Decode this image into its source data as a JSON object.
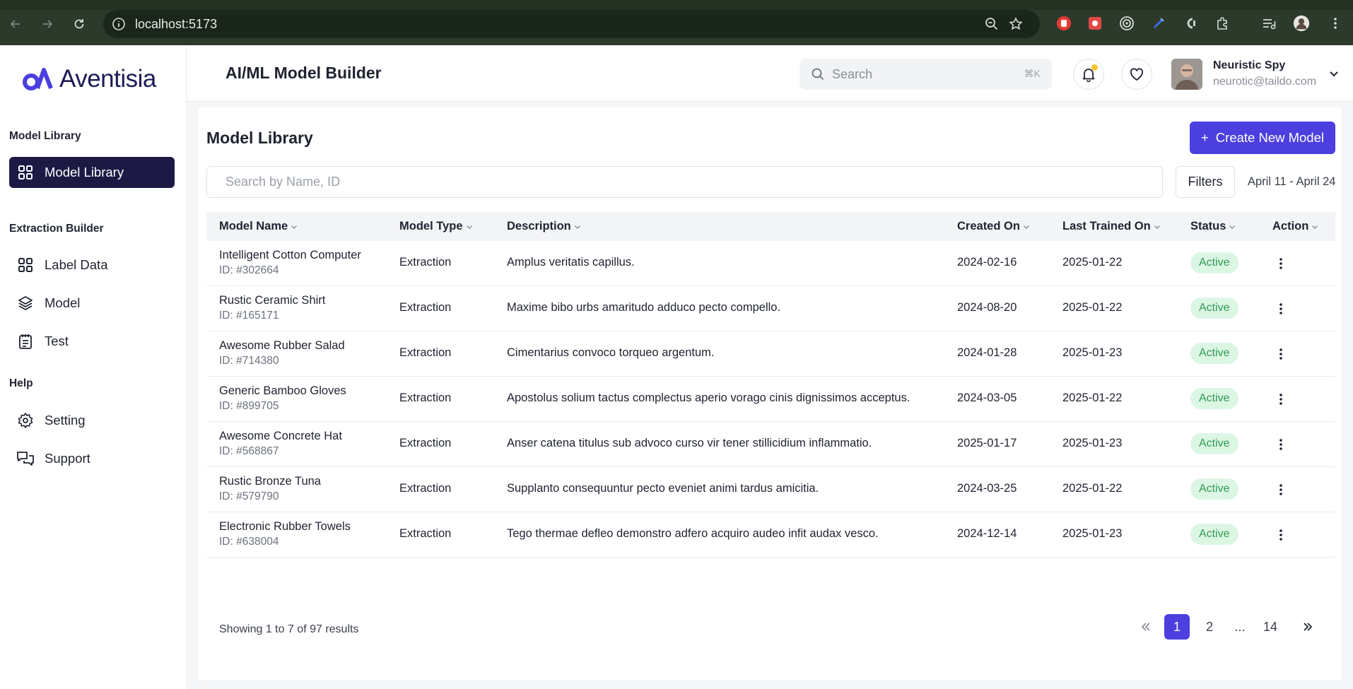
{
  "browser": {
    "url": "localhost:5173"
  },
  "brand": {
    "name": "Aventisia",
    "accent": "#4b3fe0",
    "dark": "#1c1a45"
  },
  "sidebar": {
    "sections": [
      {
        "title": "Model Library",
        "items": [
          {
            "label": "Model Library",
            "icon": "grid-icon",
            "active": true
          }
        ]
      },
      {
        "title": "Extraction Builder",
        "items": [
          {
            "label": "Label Data",
            "icon": "grid-icon"
          },
          {
            "label": "Model",
            "icon": "layers-icon"
          },
          {
            "label": "Test",
            "icon": "clipboard-icon"
          }
        ]
      },
      {
        "title": "Help",
        "items": [
          {
            "label": "Setting",
            "icon": "gear-icon"
          },
          {
            "label": "Support",
            "icon": "chat-icon"
          }
        ]
      }
    ]
  },
  "header": {
    "title": "AI/ML Model Builder",
    "search_placeholder": "Search",
    "search_shortcut": "⌘K",
    "user": {
      "name": "Neuristic Spy",
      "email": "neurotic@taildo.com"
    }
  },
  "main": {
    "title": "Model Library",
    "create_button": "Create New Model",
    "create_button_icon": "+",
    "table_search_placeholder": "Search by Name, ID",
    "filters_label": "Filters",
    "date_range": "April 11 - April 24",
    "columns": [
      "Model Name",
      "Model Type",
      "Description",
      "Created On",
      "Last Trained On",
      "Status",
      "Action"
    ],
    "rows": [
      {
        "name": "Intelligent Cotton Computer",
        "id": "ID: #302664",
        "type": "Extraction",
        "description": "Amplus veritatis capillus.",
        "created": "2024-02-16",
        "trained": "2025-01-22",
        "status": "Active"
      },
      {
        "name": "Rustic Ceramic Shirt",
        "id": "ID: #165171",
        "type": "Extraction",
        "description": "Maxime bibo urbs amaritudo adduco pecto compello.",
        "created": "2024-08-20",
        "trained": "2025-01-22",
        "status": "Active"
      },
      {
        "name": "Awesome Rubber Salad",
        "id": "ID: #714380",
        "type": "Extraction",
        "description": "Cimentarius convoco torqueo argentum.",
        "created": "2024-01-28",
        "trained": "2025-01-23",
        "status": "Active"
      },
      {
        "name": "Generic Bamboo Gloves",
        "id": "ID: #899705",
        "type": "Extraction",
        "description": "Apostolus solium tactus complectus aperio vorago cinis dignissimos acceptus.",
        "created": "2024-03-05",
        "trained": "2025-01-22",
        "status": "Active"
      },
      {
        "name": "Awesome Concrete Hat",
        "id": "ID: #568867",
        "type": "Extraction",
        "description": "Anser catena titulus sub advoco curso vir tener stillicidium inflammatio.",
        "created": "2025-01-17",
        "trained": "2025-01-23",
        "status": "Active"
      },
      {
        "name": "Rustic Bronze Tuna",
        "id": "ID: #579790",
        "type": "Extraction",
        "description": "Supplanto consequuntur pecto eveniet animi tardus amicitia.",
        "created": "2024-03-25",
        "trained": "2025-01-22",
        "status": "Active"
      },
      {
        "name": "Electronic Rubber Towels",
        "id": "ID: #638004",
        "type": "Extraction",
        "description": "Tego thermae defleo demonstro adfero acquiro audeo infit audax vesco.",
        "created": "2024-12-14",
        "trained": "2025-01-23",
        "status": "Active"
      }
    ],
    "results_text": "Showing 1 to 7 of 97 results",
    "pagination": {
      "first": "«",
      "pages": [
        "1",
        "2",
        "...",
        "14"
      ],
      "last": "»",
      "current": "1"
    }
  }
}
